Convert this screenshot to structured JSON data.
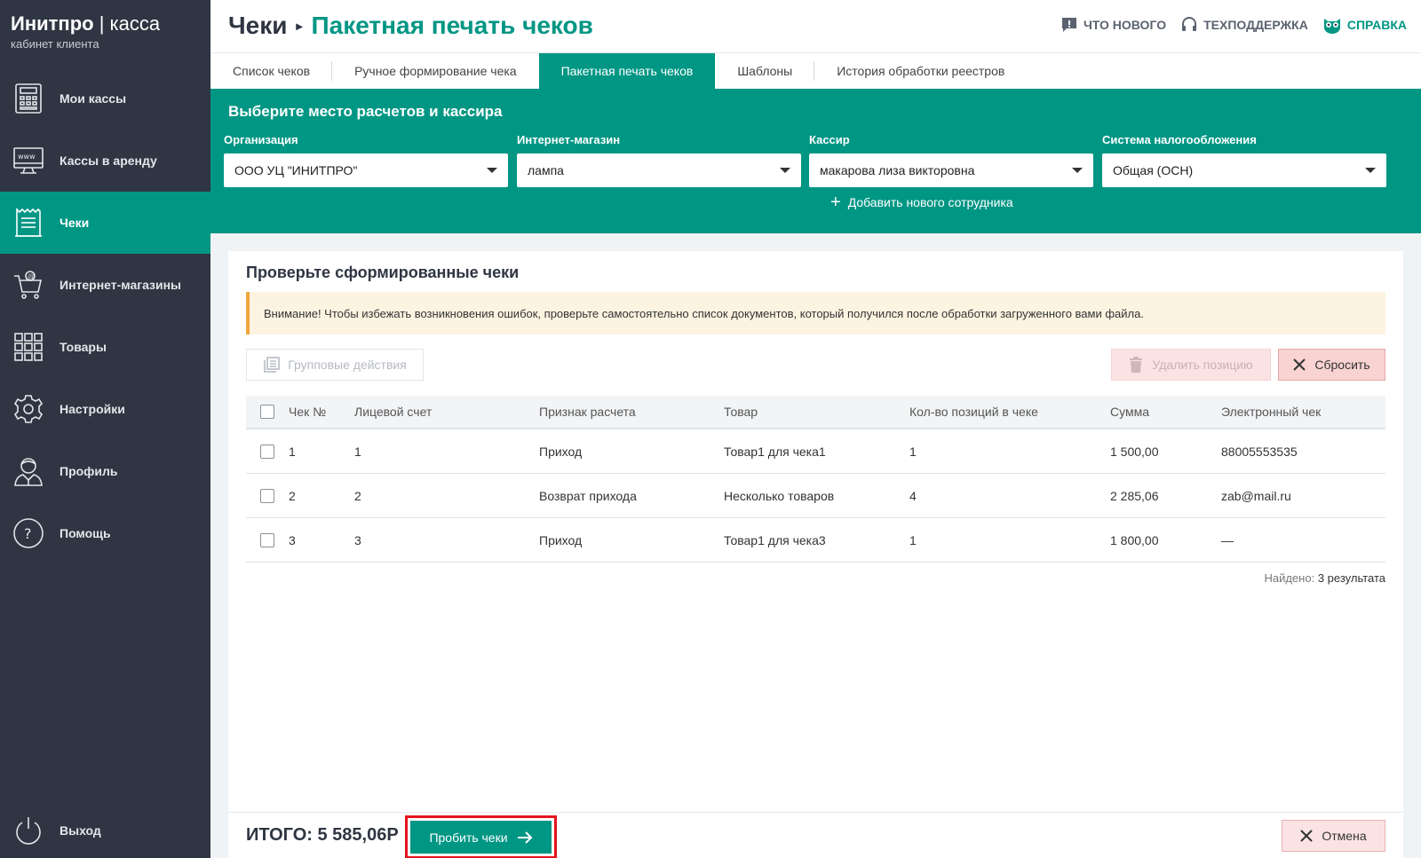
{
  "brand": {
    "name": "Инитпро",
    "separator": "|",
    "product": "касса",
    "subtitle": "кабинет клиента"
  },
  "sidebar": {
    "items": [
      {
        "label": "Мои кассы",
        "icon": "cash-register-icon"
      },
      {
        "label": "Кассы в аренду",
        "icon": "www-monitor-icon"
      },
      {
        "label": "Чеки",
        "icon": "receipt-icon",
        "active": true
      },
      {
        "label": "Интернет-магазины",
        "icon": "shopping-cart-icon"
      },
      {
        "label": "Товары",
        "icon": "grid-icon"
      },
      {
        "label": "Настройки",
        "icon": "gear-icon"
      },
      {
        "label": "Профиль",
        "icon": "user-icon"
      },
      {
        "label": "Помощь",
        "icon": "help-icon"
      }
    ],
    "logout": {
      "label": "Выход",
      "icon": "power-icon"
    }
  },
  "header": {
    "crumb_parent": "Чеки",
    "crumb_current": "Пакетная печать чеков",
    "links": {
      "news": "ЧТО НОВОГО",
      "support": "ТЕХПОДДЕРЖКА",
      "help": "СПРАВКА"
    }
  },
  "tabs": [
    "Список чеков",
    "Ручное формирование чека",
    "Пакетная печать чеков",
    "Шаблоны",
    "История обработки реестров"
  ],
  "panel": {
    "title": "Выберите место расчетов и кассира",
    "fields": [
      {
        "label": "Организация",
        "value": "ООО УЦ \"ИНИТПРО\""
      },
      {
        "label": "Интернет-магазин",
        "value": "лампа"
      },
      {
        "label": "Кассир",
        "value": "макарова лиза викторовна"
      },
      {
        "label": "Система налогообложения",
        "value": "Общая (ОСН)"
      }
    ],
    "add_employee": "Добавить нового сотрудника"
  },
  "content": {
    "title": "Проверьте сформированные чеки",
    "alert": "Внимание! Чтобы избежать возникновения ошибок, проверьте самостоятельно список документов, который получился после обработки загруженного вами файла.",
    "group_actions": "Групповые действия",
    "delete_position": "Удалить позицию",
    "reset": "Сбросить",
    "columns": [
      "Чек №",
      "Лицевой счет",
      "Признак расчета",
      "Товар",
      "Кол-во позиций в чеке",
      "Сумма",
      "Электронный чек"
    ],
    "rows": [
      [
        "1",
        "1",
        "Приход",
        "Товар1 для чека1",
        "1",
        "1 500,00",
        "88005553535"
      ],
      [
        "2",
        "2",
        "Возврат прихода",
        "Несколько товаров",
        "4",
        "2 285,06",
        "zab@mail.ru"
      ],
      [
        "3",
        "3",
        "Приход",
        "Товар1 для чека3",
        "1",
        "1 800,00",
        "—"
      ]
    ],
    "found_label": "Найдено:",
    "found_value": "3 результата"
  },
  "footer": {
    "total": "ИТОГО: 5 585,06Р",
    "submit": "Пробить чеки",
    "cancel": "Отмена"
  },
  "colors": {
    "accent": "#009684",
    "sidebar": "#2f3542",
    "highlight": "#e3121d",
    "alert_border": "#f0a63a"
  }
}
